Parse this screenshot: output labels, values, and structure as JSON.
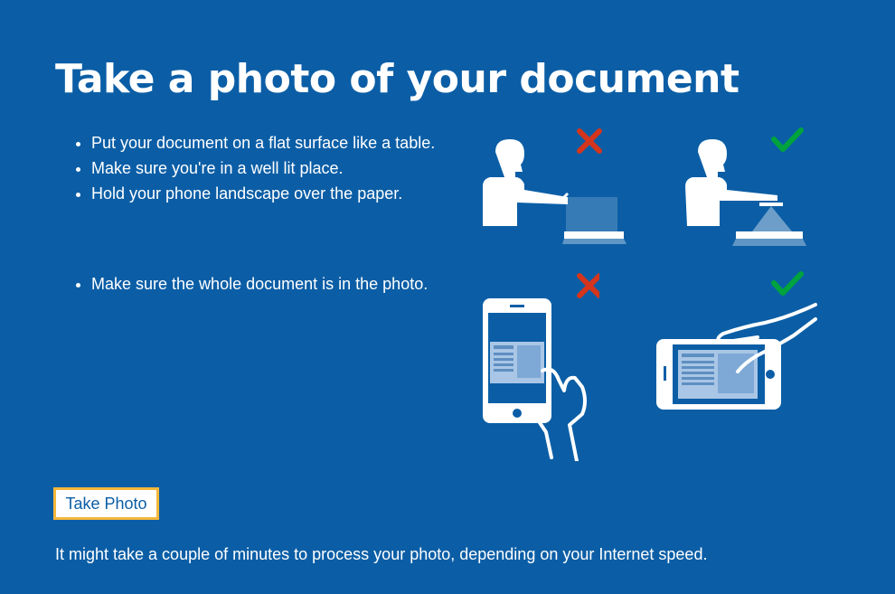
{
  "title": "Take a photo of your document",
  "instructions_group_1": [
    "Put your document on a flat surface like a table.",
    "Make sure you're in a well lit place.",
    "Hold your phone landscape over the paper."
  ],
  "instructions_group_2": [
    "Make sure the whole document is in the photo."
  ],
  "take_photo_button": "Take Photo",
  "processing_note": "It might take a couple of minutes to process your photo, depending on your Internet speed.",
  "colors": {
    "background": "#0b5ea6",
    "text": "#ffffff",
    "button_focus_border": "#f4b73a",
    "incorrect_mark": "#d4351c",
    "correct_mark": "#00a33e"
  },
  "illustrations": [
    {
      "name": "person-photographing-at-angle",
      "status": "incorrect"
    },
    {
      "name": "person-photographing-from-above",
      "status": "correct"
    },
    {
      "name": "phone-portrait-document",
      "status": "incorrect"
    },
    {
      "name": "phone-landscape-document",
      "status": "correct"
    }
  ]
}
